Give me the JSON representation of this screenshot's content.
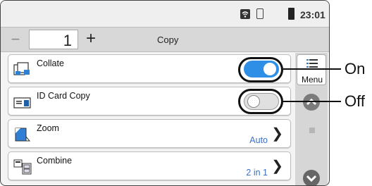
{
  "status_bar": {
    "time": "23:01"
  },
  "toolbar": {
    "minus_label": "−",
    "copies_value": "1",
    "plus_label": "+",
    "title": "Copy"
  },
  "rows": [
    {
      "label": "Collate",
      "toggle": "on"
    },
    {
      "label": "ID Card Copy",
      "toggle": "off"
    },
    {
      "label": "Zoom",
      "value": "Auto"
    },
    {
      "label": "Combine",
      "value": "2 in 1"
    }
  ],
  "side_panel": {
    "menu_label": "Menu"
  },
  "callouts": {
    "on": "On",
    "off": "Off"
  },
  "colors": {
    "toggle_on": "#2f8fe6",
    "link_value": "#3a6fc8"
  }
}
